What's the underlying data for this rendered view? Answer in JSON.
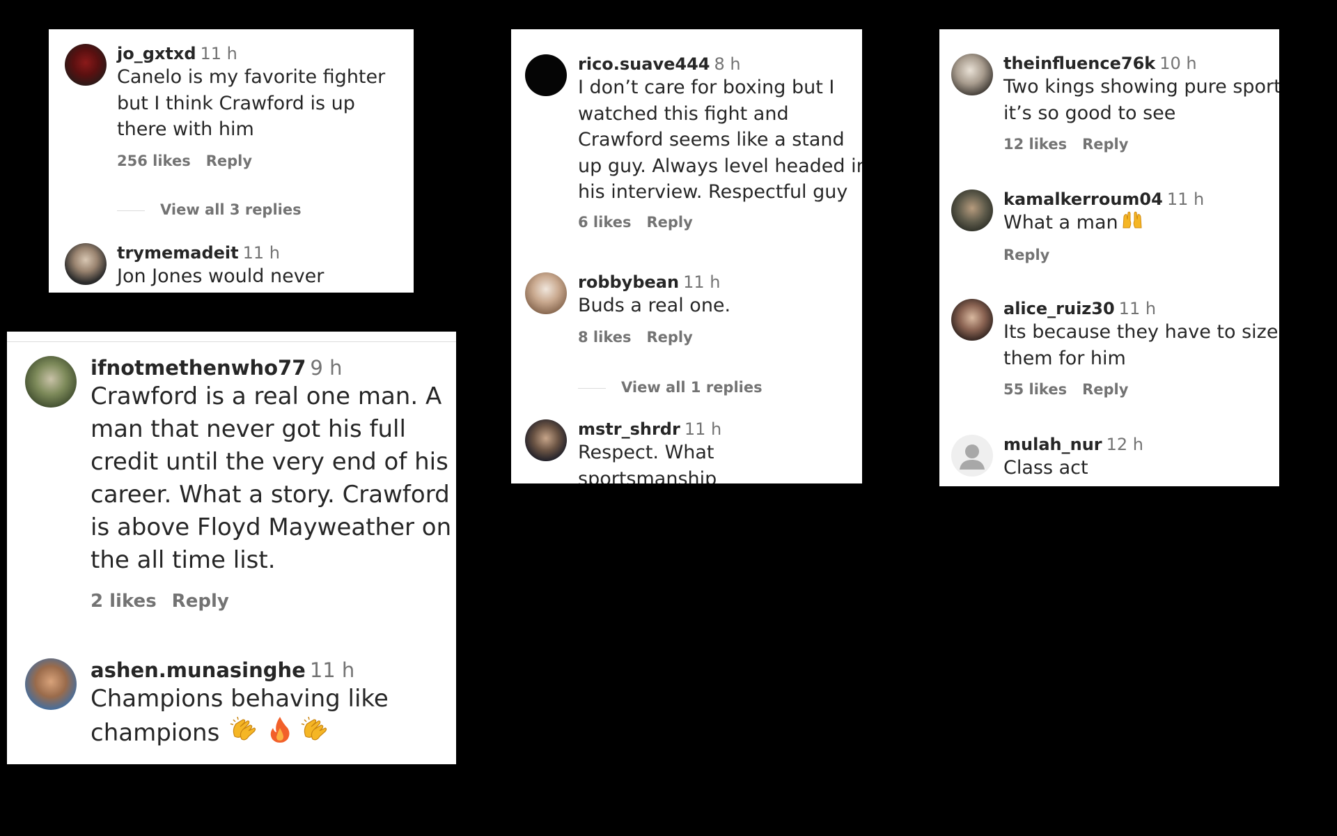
{
  "panels": [
    {
      "comments": [
        {
          "user": "jo_gxtxd",
          "time": "11 h",
          "text": "Canelo is my favorite fighter but I think Crawford is up there with him",
          "likes": "256 likes",
          "reply": "Reply",
          "view_replies": "View all 3 replies"
        },
        {
          "user": "trymemadeit",
          "time": "11 h",
          "text": "Jon Jones would never"
        }
      ]
    },
    {
      "comments": [
        {
          "user": "rico.suave444",
          "time": "8 h",
          "text": "I don’t care for boxing but I watched this fight and Crawford seems like a stand up guy. Always level headed in his interview. Respectful guy",
          "likes": "6 likes",
          "reply": "Reply"
        },
        {
          "user": "robbybean",
          "time": "11 h",
          "text": "Buds a real one.",
          "likes": "8 likes",
          "reply": "Reply",
          "view_replies": "View all 1 replies"
        },
        {
          "user": "mstr_shrdr",
          "time": "11 h",
          "text": "Respect. What sportsmanship"
        }
      ]
    },
    {
      "comments": [
        {
          "user": "theinfluence76k",
          "time": "10 h",
          "text": "Two kings showing pure sport it’s so good to see",
          "likes": "12 likes",
          "reply": "Reply"
        },
        {
          "user": "kamalkerroum04",
          "time": "11 h",
          "text": "What a man",
          "emoji": "raised-hands",
          "reply": "Reply"
        },
        {
          "user": "alice_ruiz30",
          "time": "11 h",
          "text": "Its because they have to size them for him",
          "likes": "55 likes",
          "reply": "Reply"
        },
        {
          "user": "mulah_nur",
          "time": "12 h",
          "text": "Class act"
        }
      ]
    },
    {
      "comments": [
        {
          "user": "ifnotmethenwho77",
          "time": "9 h",
          "text": "Crawford is a real one man. A man that never got his full credit until the very end of his career. What a story. Crawford is above Floyd Mayweather on the all time list.",
          "likes": "2 likes",
          "reply": "Reply"
        },
        {
          "user": "ashen.munasinghe",
          "time": "11 h",
          "text": "Champions behaving like champions",
          "emoji": "clap-fire-clap"
        }
      ]
    }
  ]
}
